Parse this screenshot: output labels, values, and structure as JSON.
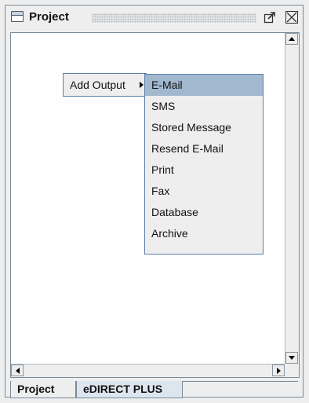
{
  "window": {
    "title": "Project"
  },
  "context_menu": {
    "parent_label": "Add Output",
    "items": [
      {
        "label": "E-Mail",
        "selected": true
      },
      {
        "label": "SMS",
        "selected": false
      },
      {
        "label": "Stored Message",
        "selected": false
      },
      {
        "label": "Resend E-Mail",
        "selected": false
      },
      {
        "label": "Print",
        "selected": false
      },
      {
        "label": "Fax",
        "selected": false
      },
      {
        "label": "Database",
        "selected": false
      },
      {
        "label": "Archive",
        "selected": false
      }
    ]
  },
  "tabs": [
    {
      "label": "Project",
      "active": false
    },
    {
      "label": "eDIRECT PLUS",
      "active": true
    }
  ],
  "icons": {
    "window": "window-icon",
    "float": "float-window-icon",
    "close": "close-icon"
  },
  "colors": {
    "selection": "#a2b8ce",
    "menu_border": "#5c7fa8",
    "active_tab": "#dde6ef"
  }
}
